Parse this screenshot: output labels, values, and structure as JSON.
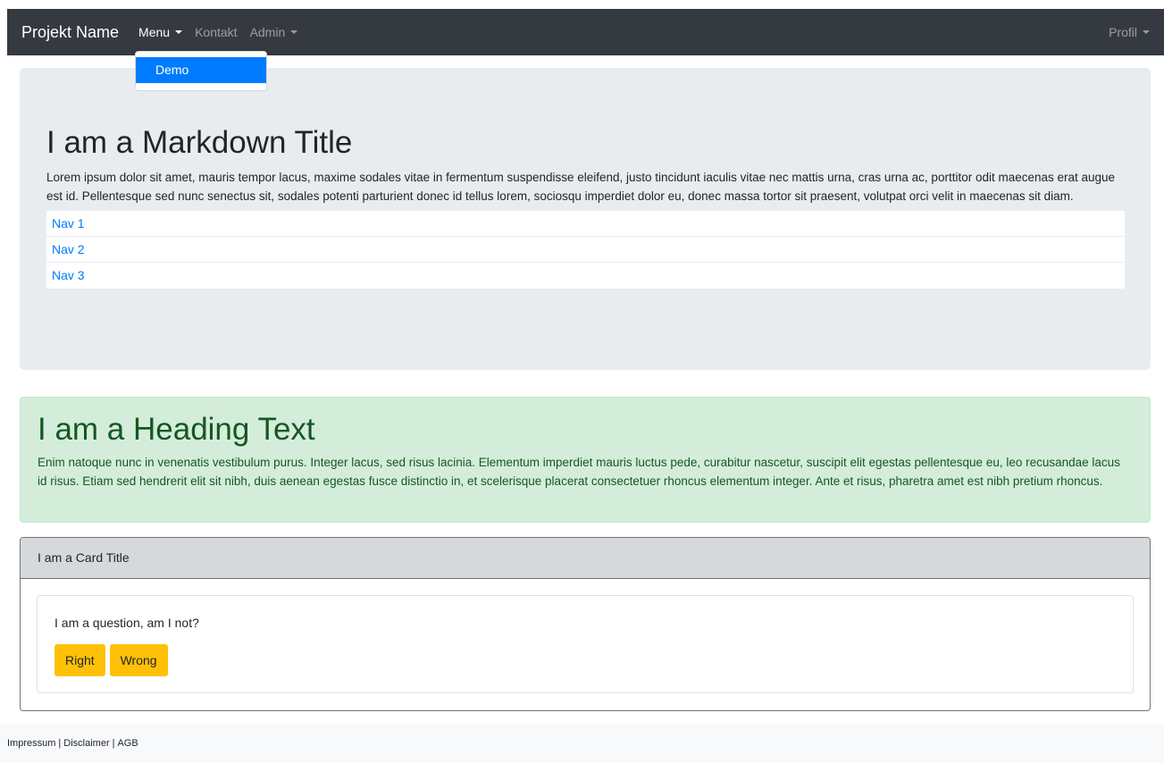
{
  "navbar": {
    "brand": "Projekt Name",
    "items": [
      {
        "label": "Menu"
      },
      {
        "label": "Kontakt"
      },
      {
        "label": "Admin"
      }
    ],
    "profile": "Profil"
  },
  "dropdown": {
    "items": [
      {
        "label": "Demo"
      }
    ]
  },
  "jumbotron": {
    "title": "I am a Markdown Title",
    "text": "Lorem ipsum dolor sit amet, mauris tempor lacus, maxime sodales vitae in fermentum suspendisse eleifend, justo tincidunt iaculis vitae nec mattis urna, cras urna ac, porttitor odit maecenas erat augue est id. Pellentesque sed nunc senectus sit, sodales potenti parturient donec id tellus lorem, sociosqu imperdiet dolor eu, donec massa tortor sit praesent, volutpat orci velit in maecenas sit diam.",
    "nav": [
      {
        "label": "Nav 1"
      },
      {
        "label": "Nav 2"
      },
      {
        "label": "Nav 3"
      }
    ]
  },
  "alert": {
    "heading": "I am a Heading Text",
    "text": "Enim natoque nunc in venenatis vestibulum purus. Integer lacus, sed risus lacinia. Elementum imperdiet mauris luctus pede, curabitur nascetur, suscipit elit egestas pellentesque eu, leo recusandae lacus id risus. Etiam sed hendrerit elit sit nibh, duis aenean egestas fusce distinctio in, et scelerisque placerat consectetuer rhoncus elementum integer. Ante et risus, pharetra amet est nibh pretium rhoncus."
  },
  "card": {
    "title": "I am a Card Title",
    "question": "I am a question, am I not?",
    "buttons": [
      {
        "label": "Right"
      },
      {
        "label": "Wrong"
      }
    ]
  },
  "footer": {
    "links": [
      {
        "label": "Impressum"
      },
      {
        "label": "Disclaimer"
      },
      {
        "label": "AGB"
      }
    ],
    "separator": "|"
  },
  "colors": {
    "navbar_bg": "#343a40",
    "primary": "#007bff",
    "jumbotron_bg": "#e9ecef",
    "alert_bg": "#d4edda",
    "alert_text": "#155724",
    "card_header_bg": "#d6d8db",
    "warning": "#ffc107",
    "footer_bg": "#f8f9fa"
  }
}
